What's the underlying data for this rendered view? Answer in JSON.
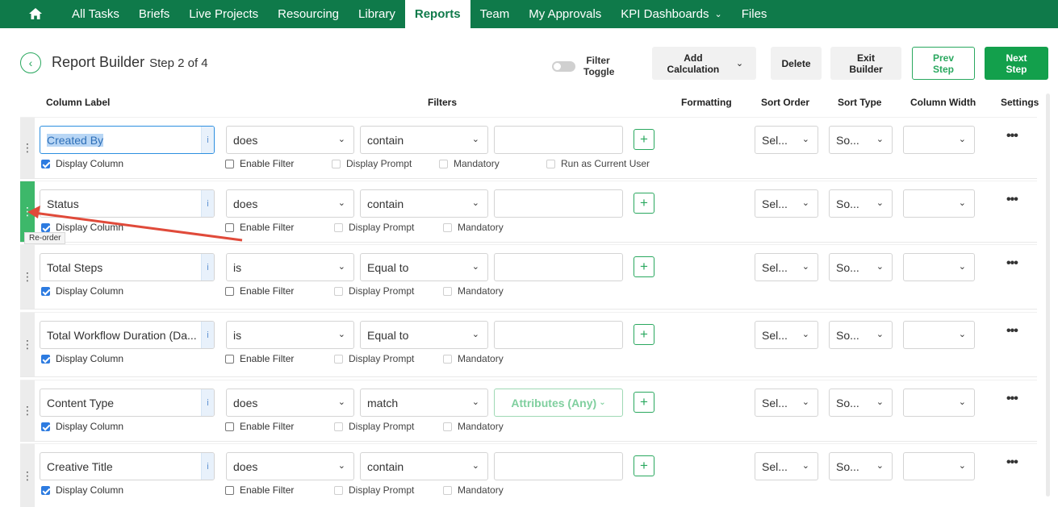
{
  "nav": {
    "items": [
      "All Tasks",
      "Briefs",
      "Live Projects",
      "Resourcing",
      "Library",
      "Reports",
      "Team",
      "My Approvals",
      "KPI Dashboards",
      "Files"
    ],
    "active": "Reports",
    "chevron": "⌄"
  },
  "header": {
    "title": "Report Builder",
    "step": "Step 2 of 4",
    "filter_toggle_label": "Filter Toggle",
    "add_calculation_label": "Add Calculation",
    "delete_label": "Delete",
    "exit_builder_label": "Exit Builder",
    "prev_step_label": "Prev Step",
    "next_step_label": "Next Step"
  },
  "columns": {
    "label": "Column Label",
    "filters": "Filters",
    "formatting": "Formatting",
    "sort_order": "Sort Order",
    "sort_type": "Sort Type",
    "column_width": "Column Width",
    "settings": "Settings"
  },
  "common": {
    "info": "i",
    "display_column": "Display Column",
    "enable_filter": "Enable Filter",
    "display_prompt": "Display Prompt",
    "mandatory": "Mandatory",
    "run_as_current_user": "Run as Current User",
    "sort_order_value": "Sel...",
    "sort_type_value": "So...",
    "plus": "+",
    "more": "•••",
    "handle": "⋮"
  },
  "tooltip": "Re-order",
  "rows": [
    {
      "label": "Created By",
      "op": "does",
      "cond": "contain",
      "value": "",
      "selected": true,
      "run_as_current_user": true
    },
    {
      "label": "Status",
      "op": "does",
      "cond": "contain",
      "value": "",
      "dragging": true
    },
    {
      "label": "Total Steps",
      "op": "is",
      "cond": "Equal to",
      "value": ""
    },
    {
      "label": "Total Workflow Duration (Da...",
      "op": "is",
      "cond": "Equal to",
      "value": ""
    },
    {
      "label": "Content Type",
      "op": "does",
      "cond": "match",
      "value": "Attributes (Any)"
    },
    {
      "label": "Creative Title",
      "op": "does",
      "cond": "contain",
      "value": ""
    }
  ],
  "colors": {
    "brand_green": "#0f7a4a",
    "accent_green": "#13a04c",
    "annotation_arrow": "#e04a3a"
  }
}
